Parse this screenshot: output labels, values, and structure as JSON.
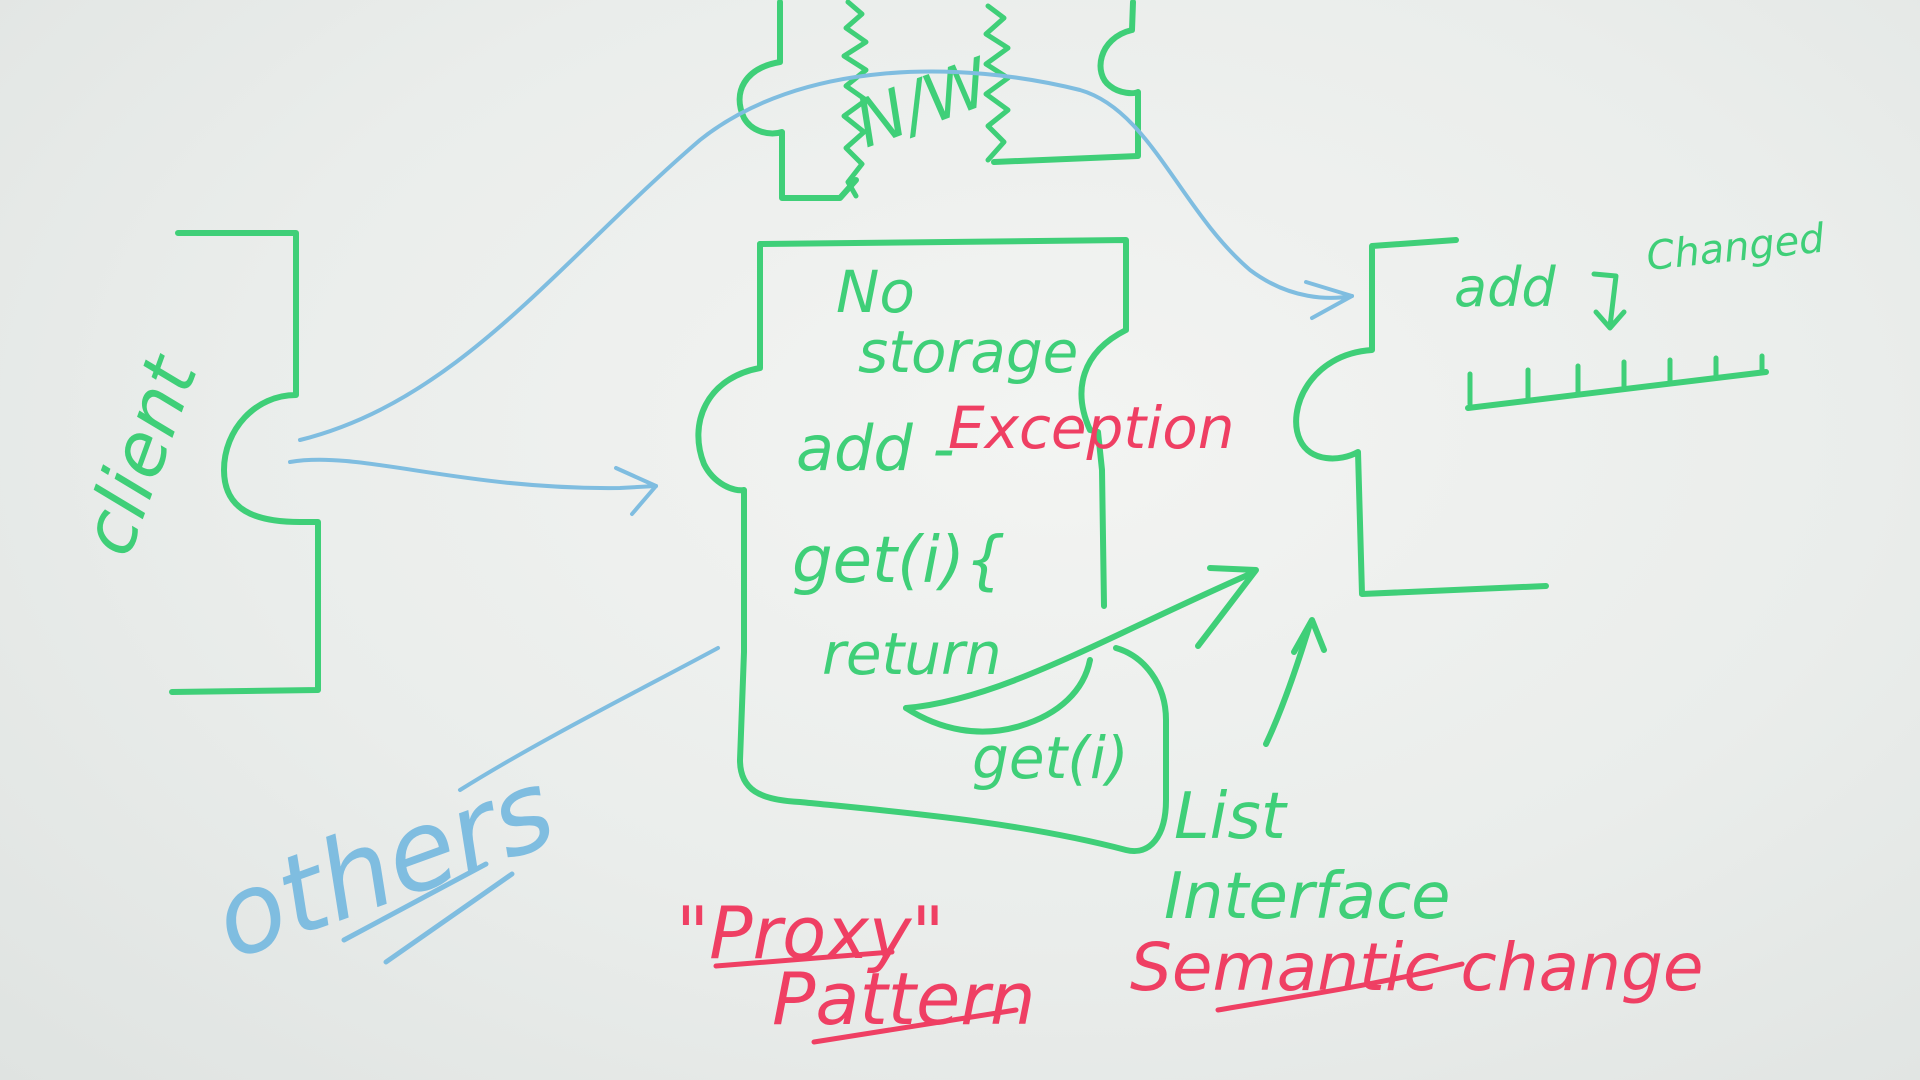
{
  "whiteboard": {
    "client_label": "client",
    "others_label": "others",
    "network_label": "N/W",
    "proxy_box": {
      "line1": "No",
      "line2": "storage",
      "line3_prefix": "add -",
      "line3_exception": "Exception",
      "line4": "get(i){",
      "line5": "return",
      "line6": "get(i)"
    },
    "right_box": {
      "add_label": "add",
      "changed_label": "Changed"
    },
    "list_interface": {
      "line1": "List",
      "line2": "Interface"
    },
    "semantic_change": "Semantic change",
    "proxy_title": "\"Proxy\"",
    "pattern_label": "Pattern"
  },
  "colors": {
    "green_marker": "#3fcf78",
    "blue_marker": "#7fbde0",
    "red_marker": "#ef3f63",
    "board": "#eef0ee"
  }
}
